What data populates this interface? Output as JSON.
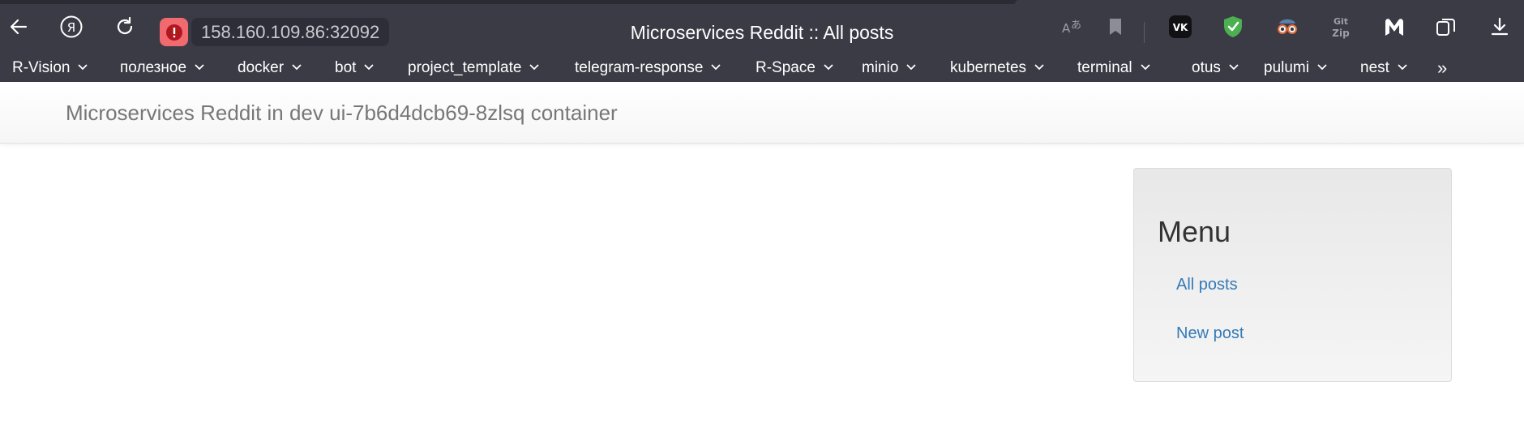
{
  "browser": {
    "address": "158.160.109.86:32092",
    "tab_title": "Microservices Reddit :: All posts",
    "icons": [
      "back-icon",
      "yandex-icon",
      "reload-icon",
      "security-warning-icon",
      "translate-icon",
      "bookmark-icon",
      "vk-icon",
      "adguard-shield-icon",
      "incognito-glasses-icon",
      "gitzip-icon",
      "malwarebytes-icon",
      "collections-icon",
      "download-icon"
    ],
    "bookmarks": [
      {
        "label": "R-Vision"
      },
      {
        "label": "полезное"
      },
      {
        "label": "docker"
      },
      {
        "label": "bot"
      },
      {
        "label": "project_template"
      },
      {
        "label": "telegram-response"
      },
      {
        "label": "R-Space"
      },
      {
        "label": "minio"
      },
      {
        "label": "kubernetes"
      },
      {
        "label": "terminal"
      },
      {
        "label": "otus"
      },
      {
        "label": "pulumi"
      },
      {
        "label": "nest"
      }
    ],
    "more": "»",
    "gitzip_text": "Git Zip"
  },
  "page": {
    "brand": "Microservices Reddit in dev ui-7b6d4dcb69-8zlsq container",
    "menu": {
      "heading": "Menu",
      "links": [
        {
          "label": "All posts"
        },
        {
          "label": "New post"
        }
      ]
    }
  },
  "colors": {
    "chrome_bg": "#3a3b45",
    "warning_red": "#f06a6f",
    "link_blue": "#337ab7",
    "adguard_green": "#4caf50"
  }
}
